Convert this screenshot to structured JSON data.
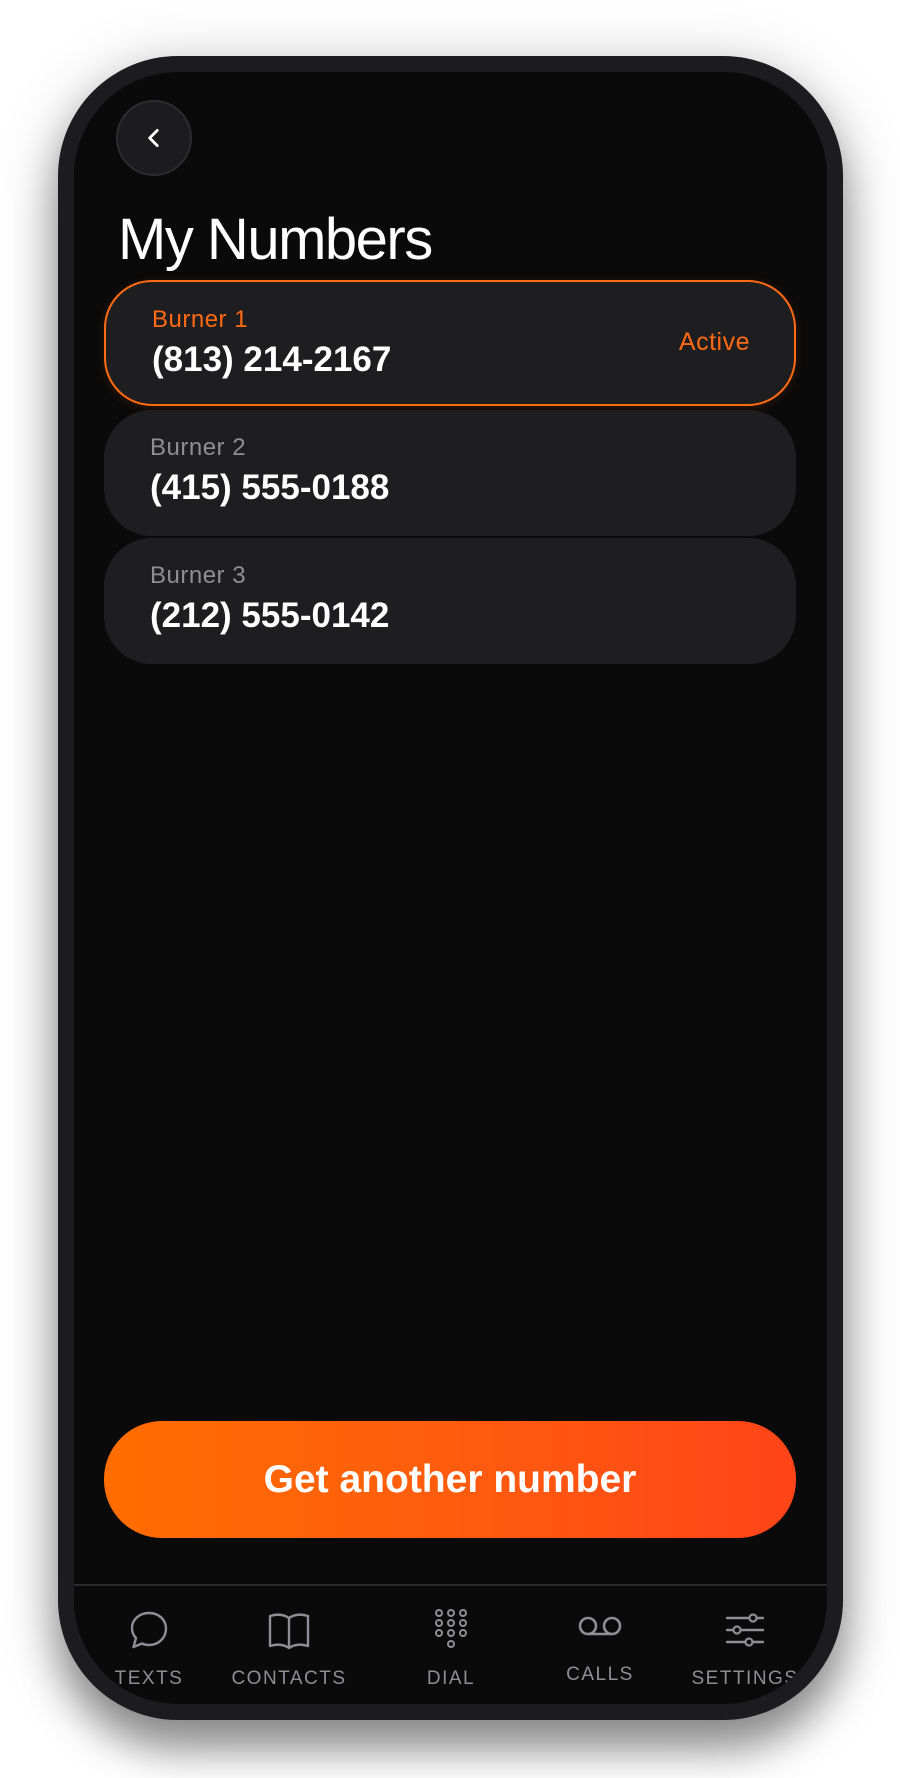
{
  "header": {
    "back_icon": "chevron-left-icon",
    "title": "My Numbers"
  },
  "numbers": [
    {
      "label": "Burner 1",
      "number": "(813) 214-2167",
      "status": "Active",
      "active": true
    },
    {
      "label": "Burner 2",
      "number": "(415) 555-0188",
      "status": "",
      "active": false
    },
    {
      "label": "Burner 3",
      "number": "(212) 555-0142",
      "status": "",
      "active": false
    }
  ],
  "cta": {
    "label": "Get another number"
  },
  "tabs": [
    {
      "label": "TEXTS",
      "icon": "chat-bubble-icon"
    },
    {
      "label": "CONTACTS",
      "icon": "book-icon"
    },
    {
      "label": "DIAL",
      "icon": "dialpad-icon"
    },
    {
      "label": "CALLS",
      "icon": "voicemail-icon"
    },
    {
      "label": "SETTINGS",
      "icon": "sliders-icon"
    }
  ],
  "colors": {
    "accent": "#ff6a13",
    "background": "#0a0a0a",
    "card": "#1e1e20",
    "muted_text": "#8e8e93"
  }
}
